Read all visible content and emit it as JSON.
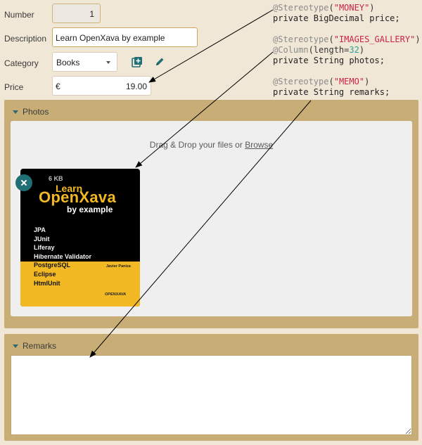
{
  "form": {
    "number": {
      "label": "Number",
      "value": "1"
    },
    "description": {
      "label": "Description",
      "value": "Learn OpenXava by example"
    },
    "category": {
      "label": "Category",
      "value": "Books"
    },
    "price": {
      "label": "Price",
      "currency": "€",
      "value": "19.00"
    }
  },
  "icons": {
    "add": "add-icon",
    "edit": "pencil-icon"
  },
  "code": {
    "stereotype_money_ann": "@Stereotype",
    "money_str": "\"MONEY\"",
    "price_line": "private BigDecimal price;",
    "stereotype_gallery_ann": "@Stereotype",
    "gallery_str": "\"IMAGES_GALLERY\"",
    "column_ann": "@Column",
    "column_args": "(length=",
    "column_num": "32",
    "photos_line": "private String photos;",
    "stereotype_memo_ann": "@Stereotype",
    "memo_str": "\"MEMO\"",
    "remarks_line": "private String remarks;"
  },
  "photos": {
    "title": "Photos",
    "dropzone_text": "Drag & Drop your files or",
    "browse_link": "Browse",
    "image": {
      "size": "6 KB",
      "title_line1": "Learn",
      "title_line2": "OpenXava",
      "title_line3": "by example",
      "topics": [
        "JPA",
        "JUnit",
        "Liferay",
        "Hibernate Validator",
        "PostgreSQL",
        "Eclipse",
        "HtmlUnit"
      ],
      "author": "Javier Paniza",
      "publisher": "OPENXAVA"
    }
  },
  "remarks": {
    "title": "Remarks",
    "value": ""
  },
  "colors": {
    "accent": "#1f6f74",
    "section_bg": "#c9ad76",
    "page_bg": "#f1e7d7",
    "code_string": "#cc2244"
  }
}
